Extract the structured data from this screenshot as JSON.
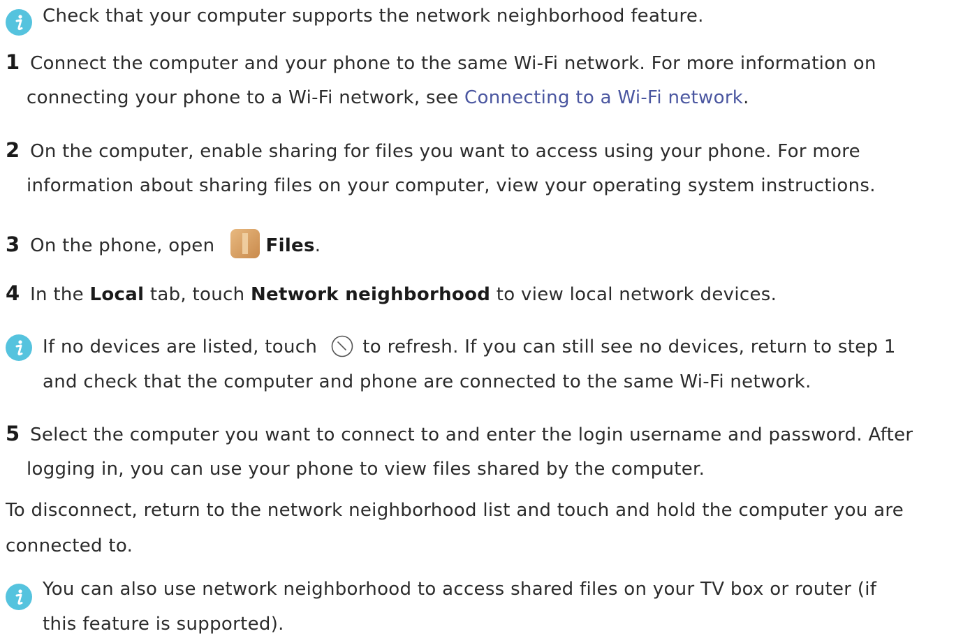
{
  "note1": {
    "icon": "info-icon",
    "text": "Check that your computer supports the network neighborhood feature."
  },
  "step1": {
    "number": "1",
    "line1": "Connect the computer and your phone to the same Wi-Fi network. For more information on",
    "line2_pre": "connecting your phone to a Wi-Fi network, see ",
    "link": "Connecting to a Wi-Fi network",
    "line2_post": "."
  },
  "step2": {
    "number": "2",
    "line1": "On the computer, enable sharing for files you want to access using your phone. For more",
    "line2": "information about sharing files on your computer, view your operating system instructions."
  },
  "step3": {
    "number": "3",
    "pre": "On the phone, open",
    "icon": "files-app-icon",
    "app": "Files",
    "post": "."
  },
  "step4": {
    "number": "4",
    "pre": "In the ",
    "tab": "Local",
    "mid": " tab, touch ",
    "item": "Network neighborhood",
    "post": " to view local network devices."
  },
  "note2": {
    "icon": "info-icon",
    "line1_pre": "If no devices are listed, touch",
    "refresh_icon": "refresh-icon",
    "line1_post": "to refresh. If you can still see no devices, return to step 1",
    "line2": "and check that the computer and phone are connected to the same Wi-Fi network."
  },
  "step5": {
    "number": "5",
    "line1": "Select the computer you want to connect to and enter the login username and password. After",
    "line2": "logging in, you can use your phone to view files shared by the computer."
  },
  "para": {
    "line1": "To disconnect, return to the network neighborhood list and touch and hold the computer you are",
    "line2": "connected to."
  },
  "note3": {
    "icon": "info-icon",
    "line1": "You can also use network neighborhood to access shared files on your TV box or router (if",
    "line2": "this feature is supported)."
  },
  "colors": {
    "info_icon": "#55c3de",
    "link": "#4a56a0",
    "text": "#2b2b2b"
  }
}
